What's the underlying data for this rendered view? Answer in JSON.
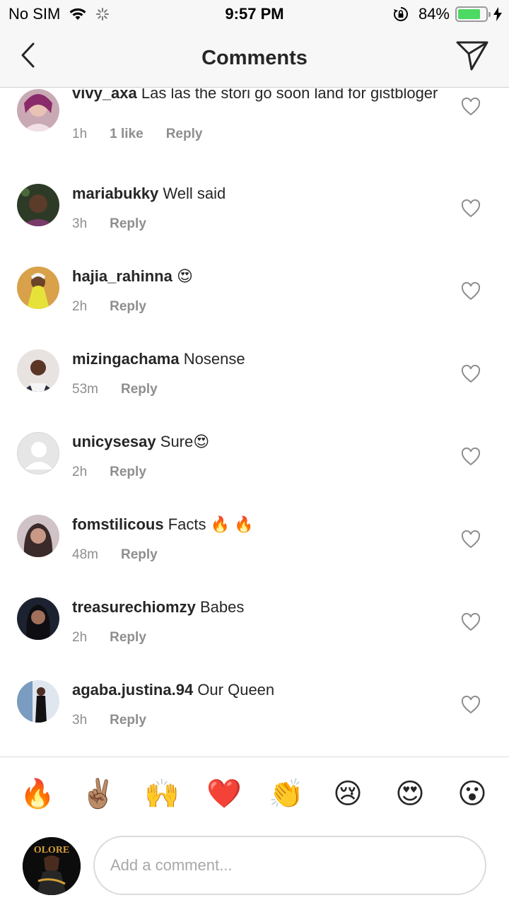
{
  "status_bar": {
    "carrier": "No SIM",
    "time": "9:57 PM",
    "battery_text": "84%",
    "battery_level": 0.84,
    "battery_color": "#4cd964"
  },
  "nav": {
    "title": "Comments",
    "back_icon": "chevron-left-icon",
    "send_icon": "paper-plane-icon"
  },
  "comments": [
    {
      "username": "vivy_axa",
      "text": "Las las the stori go soon land for gistbloger",
      "time": "1h",
      "likes": "1 like",
      "reply": "Reply"
    },
    {
      "username": "mariabukky",
      "text": "Well said",
      "time": "3h",
      "reply": "Reply"
    },
    {
      "username": "hajia_rahinna",
      "text": "😍",
      "time": "2h",
      "reply": "Reply"
    },
    {
      "username": "mizingachama",
      "text": "Nosense",
      "time": "53m",
      "reply": "Reply"
    },
    {
      "username": "unicysesay",
      "text": "Sure😍",
      "time": "2h",
      "reply": "Reply"
    },
    {
      "username": "fomstilicous",
      "text": "Facts  🔥 🔥",
      "time": "48m",
      "reply": "Reply"
    },
    {
      "username": "treasurechiomzy",
      "text": "Babes",
      "time": "2h",
      "reply": "Reply"
    },
    {
      "username": "agaba.justina.94",
      "text": "Our Queen",
      "time": "3h",
      "reply": "Reply"
    }
  ],
  "reactions": [
    "🔥",
    "✌🏽",
    "🙌",
    "❤️",
    "👏",
    "😢",
    "😍",
    "😮"
  ],
  "composer": {
    "placeholder": "Add a comment...",
    "avatar_text": "OLORE"
  }
}
